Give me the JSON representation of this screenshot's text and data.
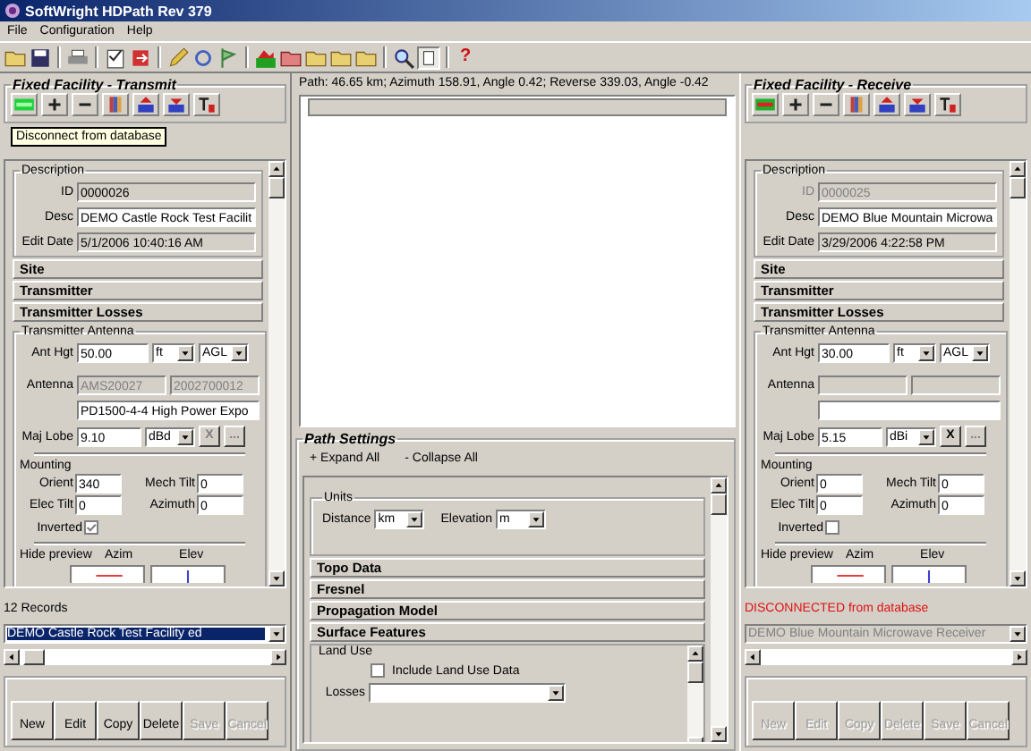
{
  "window": {
    "title": "SoftWright HDPath Rev 379"
  },
  "menu": [
    {
      "label": "File"
    },
    {
      "label": "Configuration"
    },
    {
      "label": "Help"
    }
  ],
  "toolbar": {
    "help_label": "?"
  },
  "facilities": [
    {
      "title": "Fixed Facility - Transmit",
      "connected": true,
      "tooltip": "Disconnect from database",
      "description": {
        "title": "Description",
        "id_label": "ID",
        "id": "0000026",
        "desc_label": "Desc",
        "desc": "DEMO Castle Rock Test Facilit",
        "date_label": "Edit Date",
        "edit_date": "5/1/2006 10:40:16 AM"
      },
      "sections": [
        {
          "label": "Site"
        },
        {
          "label": "Transmitter"
        },
        {
          "label": "Transmitter Losses"
        }
      ],
      "antenna": {
        "title": "Transmitter Antenna",
        "hgt_label": "Ant Hgt",
        "hgt": "50.00",
        "unit": "ft",
        "ref": "AGL",
        "antenna_label": "Antenna",
        "code_1": "AMS20027",
        "code_2": "2002700012",
        "model": "PD1500-4-4 High Power Expo",
        "lobe_label": "Maj Lobe",
        "lobe": "9.10",
        "lobe_unit": "dBd",
        "clear_label": "X",
        "browse_label": "...",
        "mounting_title": "Mounting",
        "orient_label": "Orient",
        "orient": "340",
        "mech_label": "Mech Tilt",
        "mech": "0",
        "elec_label": "Elec Tilt",
        "elec": "0",
        "azimuth_label": "Azimuth",
        "azimuth": "0",
        "inverted_label": "Inverted",
        "inverted": true,
        "preview_label": "Hide preview",
        "azim_label": "Azim",
        "elev_label": "Elev"
      },
      "status": "12 Records",
      "record": "DEMO Castle Rock Test Facility ed",
      "buttons": [
        {
          "label": "New",
          "disabled": false
        },
        {
          "label": "Edit",
          "disabled": false
        },
        {
          "label": "Copy",
          "disabled": false
        },
        {
          "label": "Delete",
          "disabled": false
        },
        {
          "label": "Save",
          "disabled": true
        },
        {
          "label": "Cancel",
          "disabled": true
        }
      ]
    },
    {
      "title": "Fixed Facility - Receive",
      "connected": false,
      "description": {
        "title": "Description",
        "id_label": "ID",
        "id": "0000025",
        "desc_label": "Desc",
        "desc": "DEMO Blue Mountain Microwa",
        "date_label": "Edit Date",
        "edit_date": "3/29/2006 4:22:58 PM"
      },
      "sections": [
        {
          "label": "Site"
        },
        {
          "label": "Transmitter"
        },
        {
          "label": "Transmitter Losses"
        }
      ],
      "antenna": {
        "title": "Transmitter Antenna",
        "hgt_label": "Ant Hgt",
        "hgt": "30.00",
        "unit": "ft",
        "ref": "AGL",
        "antenna_label": "Antenna",
        "lobe_label": "Maj Lobe",
        "lobe": "5.15",
        "lobe_unit": "dBi",
        "clear_label": "X",
        "browse_label": "...",
        "mounting_title": "Mounting",
        "orient_label": "Orient",
        "orient": "0",
        "mech_label": "Mech Tilt",
        "mech": "0",
        "elec_label": "Elec Tilt",
        "elec": "0",
        "azimuth_label": "Azimuth",
        "azimuth": "0",
        "inverted_label": "Inverted",
        "inverted": false,
        "preview_label": "Hide preview",
        "azim_label": "Azim",
        "elev_label": "Elev"
      },
      "status": "DISCONNECTED from database",
      "record": "DEMO Blue Mountain Microwave Receiver",
      "buttons": [
        {
          "label": "New",
          "disabled": true
        },
        {
          "label": "Edit",
          "disabled": true
        },
        {
          "label": "Copy",
          "disabled": true
        },
        {
          "label": "Delete",
          "disabled": true
        },
        {
          "label": "Save",
          "disabled": true
        },
        {
          "label": "Cancel",
          "disabled": true
        }
      ]
    }
  ],
  "path": {
    "info": "Path: 46.65 km; Azimuth 158.91, Angle 0.42; Reverse 339.03, Angle -0.42"
  },
  "path_settings": {
    "title": "Path Settings",
    "expand": "+ Expand All",
    "collapse": "- Collapse All",
    "units": {
      "title": "Units",
      "distance_label": "Distance",
      "distance": "km",
      "elevation_label": "Elevation",
      "elevation": "m"
    },
    "sections": [
      {
        "label": "Topo Data"
      },
      {
        "label": "Fresnel"
      },
      {
        "label": "Propagation Model"
      },
      {
        "label": "Surface Features"
      }
    ],
    "land_use": {
      "title": "Land Use",
      "include_label": "Include Land Use Data",
      "include": false,
      "losses_label": "Losses"
    }
  }
}
